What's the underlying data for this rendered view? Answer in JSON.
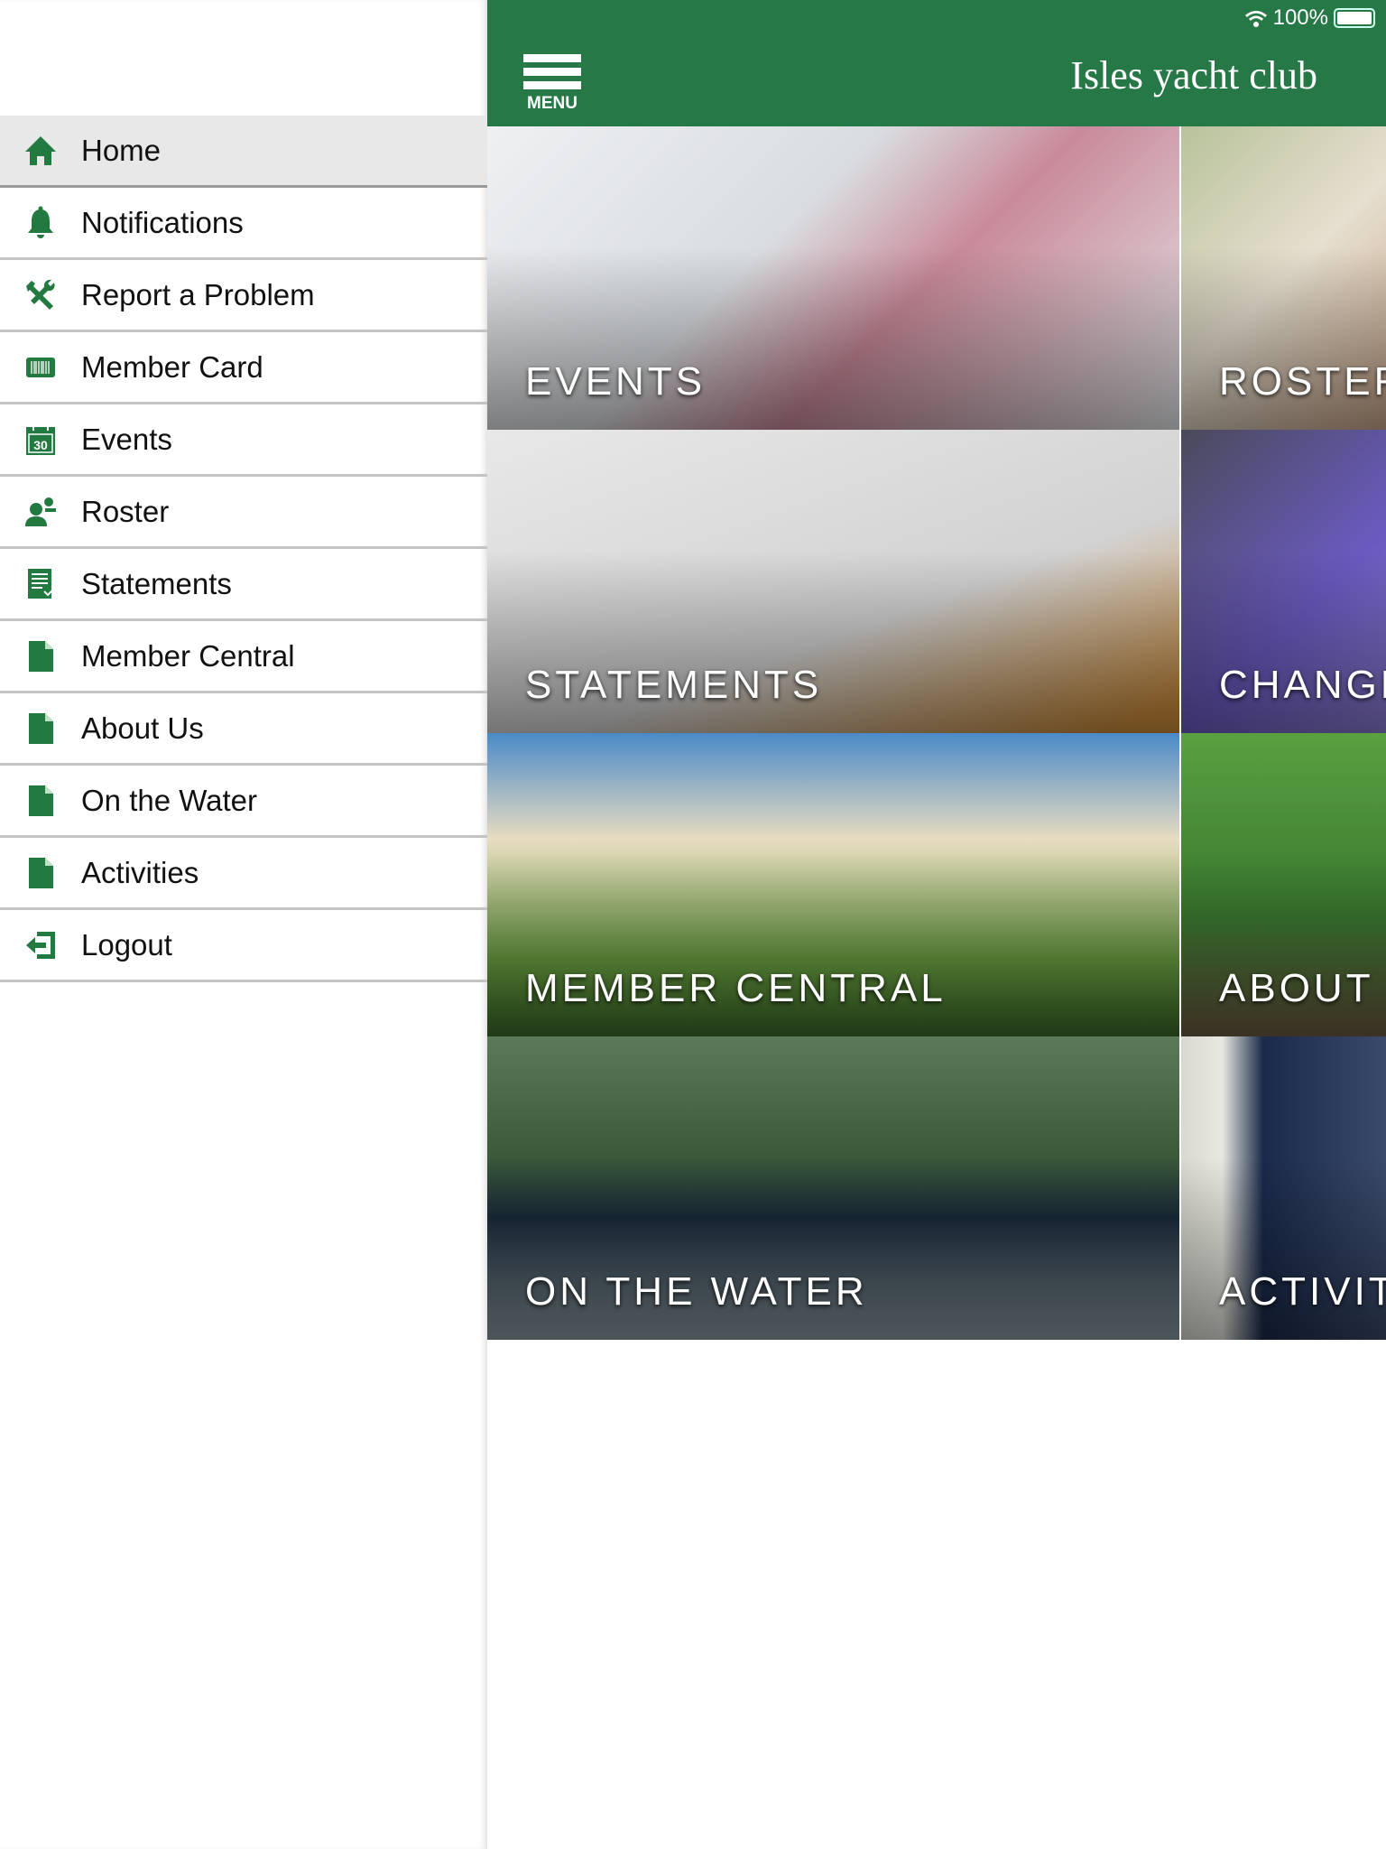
{
  "status": {
    "battery": "100%",
    "battery_level": 100
  },
  "header": {
    "menu_label": "MENU",
    "title": "Isles yacht club",
    "color": "#267847"
  },
  "sidebar": {
    "items": [
      {
        "label": "Home",
        "icon": "home-icon",
        "active": true
      },
      {
        "label": "Notifications",
        "icon": "bell-icon"
      },
      {
        "label": "Report a Problem",
        "icon": "tools-icon"
      },
      {
        "label": "Member Card",
        "icon": "barcode-card-icon"
      },
      {
        "label": "Events",
        "icon": "calendar-icon",
        "badge": "30"
      },
      {
        "label": "Roster",
        "icon": "people-icon"
      },
      {
        "label": "Statements",
        "icon": "statement-icon"
      },
      {
        "label": "Member Central",
        "icon": "document-icon"
      },
      {
        "label": "About Us",
        "icon": "document-icon"
      },
      {
        "label": "On the Water",
        "icon": "document-icon"
      },
      {
        "label": "Activities",
        "icon": "document-icon"
      },
      {
        "label": "Logout",
        "icon": "logout-icon"
      }
    ]
  },
  "tiles": [
    {
      "label": "EVENTS",
      "bg": "linear-gradient(135deg,#eef0f2,#d9dde0 40%,#c98a9a 60%,#e5e8ea)"
    },
    {
      "label": "ROSTER",
      "bg": "linear-gradient(135deg,#b8c29a,#e6dfcf 50%,#c9a58a)"
    },
    {
      "label": "STATEMENTS",
      "bg": "linear-gradient(160deg,#e8e8e8,#d2d2d2 60%,#c98a3a 95%)"
    },
    {
      "label": "CHANGE",
      "bg": "linear-gradient(135deg,#4a4a5a,#6a5ac0 60%,#8a7ad0)"
    },
    {
      "label": "MEMBER CENTRAL",
      "bg": "linear-gradient(180deg,#4a8ac8,#e8dcc0 35%,#6aa040 75%,#3a6a2a)"
    },
    {
      "label": "ABOUT",
      "bg": "linear-gradient(180deg,#5aa040,#3a7a30 60%,#6a5a40)"
    },
    {
      "label": "ON THE WATER",
      "bg": "linear-gradient(180deg,#5a7a5a,#3a5a3a 40%,#1a2a3a 60%,#8a9aa0)"
    },
    {
      "label": "ACTIVIT",
      "bg": "linear-gradient(90deg,#d8d8d0,#e8e8e0 20%,#1a2a4a 40%,#3a4a6a)"
    }
  ]
}
